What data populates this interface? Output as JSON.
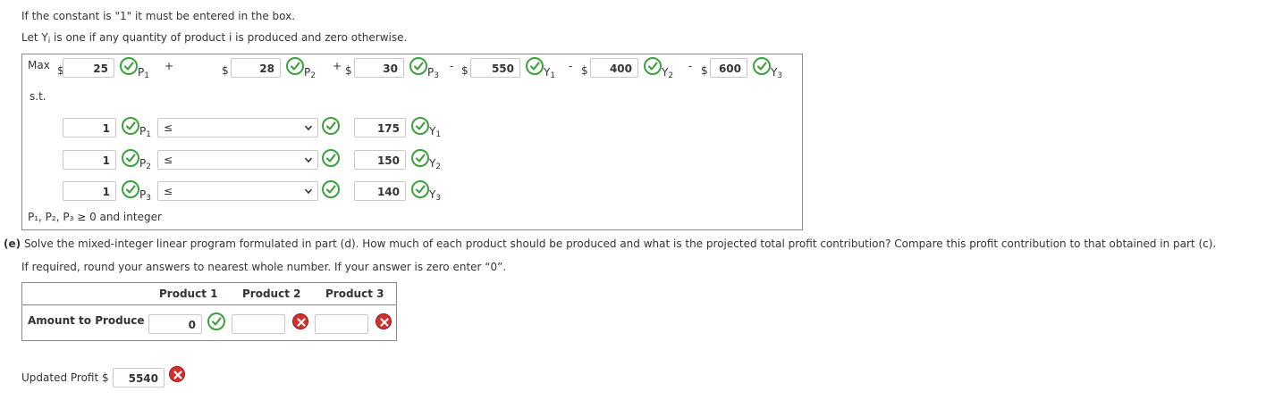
{
  "intro": {
    "line1": "If the constant is \"1\" it must be entered in the box.",
    "line2_prefix": "Let Y",
    "line2_sub": "i",
    "line2_suffix": " is one if any quantity of product i is produced and zero otherwise."
  },
  "objective": {
    "label": "Max",
    "terms": [
      {
        "sign": "",
        "dollar": "$",
        "value": "25",
        "var": "P",
        "sub": "1"
      },
      {
        "sign": "+",
        "dollar": "$",
        "value": "28",
        "var": "P",
        "sub": "2"
      },
      {
        "sign": "+",
        "dollar": "$",
        "value": "30",
        "var": "P",
        "sub": "3"
      },
      {
        "sign": "-",
        "dollar": "$",
        "value": "550",
        "var": "Y",
        "sub": "1"
      },
      {
        "sign": "-",
        "dollar": "$",
        "value": "400",
        "var": "Y",
        "sub": "2"
      },
      {
        "sign": "-",
        "dollar": "$",
        "value": "600",
        "var": "Y",
        "sub": "3"
      }
    ]
  },
  "constraints": {
    "label": "s.t.",
    "rows": [
      {
        "coef": "1",
        "var": "P",
        "sub": "1",
        "op": "≤",
        "rhs": "175",
        "yvar": "Y",
        "ysub": "1"
      },
      {
        "coef": "1",
        "var": "P",
        "sub": "2",
        "op": "≤",
        "rhs": "150",
        "yvar": "Y",
        "ysub": "2"
      },
      {
        "coef": "1",
        "var": "P",
        "sub": "3",
        "op": "≤",
        "rhs": "140",
        "yvar": "Y",
        "ysub": "3"
      }
    ],
    "nonneg": "P₁, P₂, P₃ ≥ 0 and integer"
  },
  "part_e": {
    "tag": "(e)",
    "question": "Solve the mixed-integer linear program formulated in part (d). How much of each product should be produced and what is the projected total profit contribution? Compare this profit contribution to that obtained in part (c).",
    "instruction": "If required, round your answers to nearest whole number. If your answer is zero enter “0”."
  },
  "answer_table": {
    "headers": [
      "Product 1",
      "Product 2",
      "Product 3"
    ],
    "row_label": "Amount to Produce",
    "values": [
      "0",
      "",
      ""
    ],
    "status": [
      "correct",
      "incorrect",
      "incorrect"
    ]
  },
  "updated_profit": {
    "label": "Updated Profit $",
    "value": "5540",
    "status": "incorrect"
  },
  "colors": {
    "correct": "#3da13d",
    "incorrect": "#d32f2f",
    "border": "#8a8a8a"
  },
  "icons": {
    "correct": "check-circle-icon",
    "incorrect": "x-circle-icon",
    "dropdown": "chevron-down-icon"
  }
}
